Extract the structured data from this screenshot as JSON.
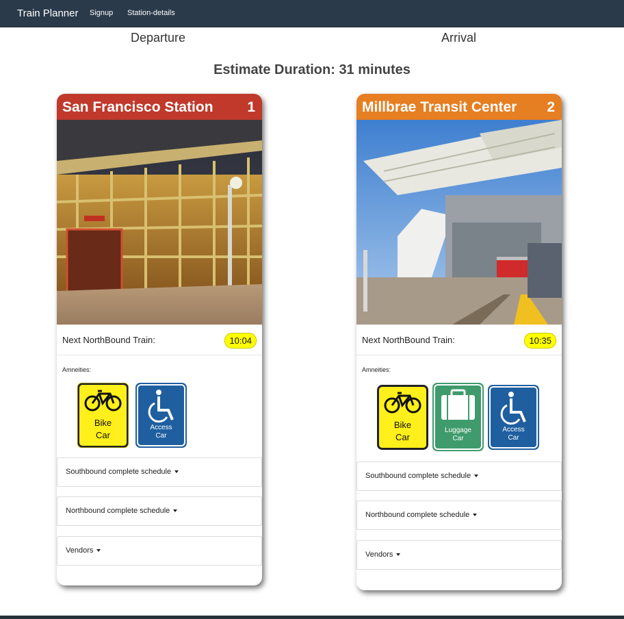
{
  "nav": {
    "brand": "Train Planner",
    "links": [
      "Signup",
      "Station-details"
    ]
  },
  "headings": {
    "departure": "Departure",
    "arrival": "Arrival"
  },
  "duration": "Estimate Duration: 31 minutes",
  "departure_card": {
    "station": "San Francisco Station",
    "number": "1",
    "header_color": "#c0392b",
    "next_label": "Next NorthBound Train:",
    "next_time": "10:04",
    "amenities_label": "Amneities:",
    "amenities": [
      {
        "icon": "bike-icon",
        "line1": "Bike",
        "line2": "Car"
      },
      {
        "icon": "wheelchair-icon",
        "line1": "Access",
        "line2": "Car"
      }
    ],
    "dropdowns": [
      "Southbound complete schedule",
      "Northbound complete schedule",
      "Vendors"
    ]
  },
  "arrival_card": {
    "station": "Millbrae Transit Center",
    "number": "2",
    "header_color": "#e67e22",
    "next_label": "Next NorthBound Train:",
    "next_time": "10:35",
    "amenities_label": "Amneities:",
    "amenities": [
      {
        "icon": "bike-icon",
        "line1": "Bike",
        "line2": "Car"
      },
      {
        "icon": "luggage-icon",
        "line1": "Luggage",
        "line2": "Car"
      },
      {
        "icon": "wheelchair-icon",
        "line1": "Access",
        "line2": "Car"
      }
    ],
    "dropdowns": [
      "Southbound complete schedule",
      "Northbound complete schedule",
      "Vendors"
    ]
  }
}
